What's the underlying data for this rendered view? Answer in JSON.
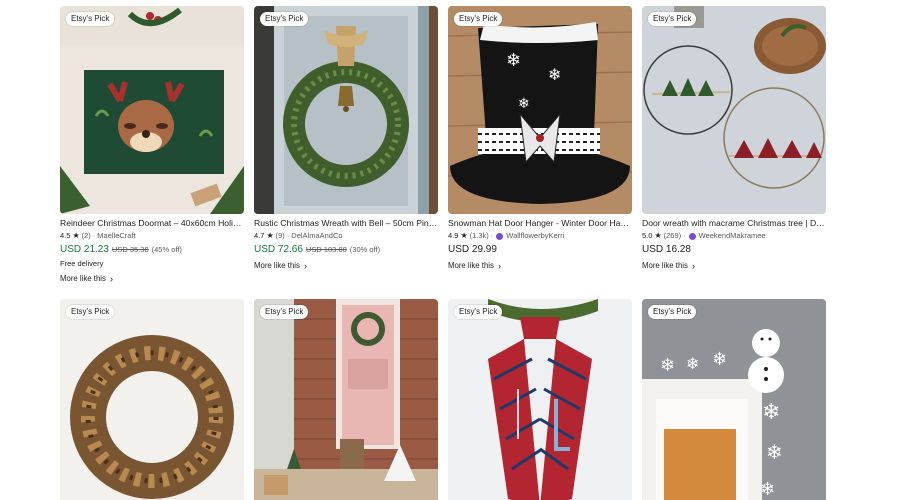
{
  "colors": {
    "sale_price": "#1a7a3a",
    "badge_bg": "#ffffff",
    "seller_star_icon": "#7a4ccc"
  },
  "row1": [
    {
      "badge": "Etsy's Pick",
      "title": "Reindeer Christmas Doormat – 40x60cm Holi…",
      "rating": "4.5",
      "reviews": "(2)",
      "seller": "MaelleCraft",
      "star_seller": false,
      "price": "USD 21.23",
      "original_price": "USD 35.38",
      "discount": "(45% off)",
      "delivery": "Free delivery",
      "more_like_this": "More like this"
    },
    {
      "badge": "Etsy's Pick",
      "title": "Rustic Christmas Wreath with Bell – 50cm Pin…",
      "rating": "4.7",
      "reviews": "(9)",
      "seller": "DelAlmaAndCo",
      "star_seller": false,
      "price": "USD 72.66",
      "original_price": "USD 103.80",
      "discount": "(30% off)",
      "more_like_this": "More like this"
    },
    {
      "badge": "Etsy's Pick",
      "title": "Snowman Hat Door Hanger - Winter Door Ha…",
      "rating": "4.9",
      "reviews": "(1.3k)",
      "seller": "WallflowerbyKerri",
      "star_seller": true,
      "price": "USD 29.99",
      "more_like_this": "More like this"
    },
    {
      "badge": "Etsy's Pick",
      "title": "Door wreath with macrame Christmas tree | D…",
      "rating": "5.0",
      "reviews": "(269)",
      "seller": "WeekendMakramee",
      "star_seller": true,
      "price": "USD 16.28",
      "more_like_this": "More like this"
    }
  ],
  "row2": [
    {
      "badge": "Etsy's Pick"
    },
    {
      "badge": "Etsy's Pick"
    },
    {
      "badge": "Etsy's Pick"
    },
    {
      "badge": "Etsy's Pick"
    }
  ],
  "glyphs": {
    "star": "★",
    "arrow": "›",
    "dot": "·"
  }
}
